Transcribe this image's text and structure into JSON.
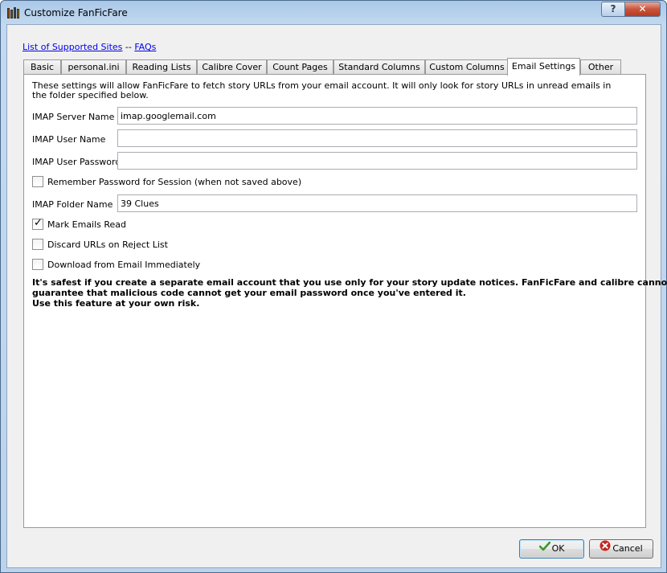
{
  "window": {
    "title": "Customize FanFicFare"
  },
  "links": {
    "supported_sites": "List of Supported Sites",
    "separator": "--",
    "faqs": "FAQs"
  },
  "tabs": [
    {
      "label": "Basic"
    },
    {
      "label": "personal.ini"
    },
    {
      "label": "Reading Lists"
    },
    {
      "label": "Calibre Cover"
    },
    {
      "label": "Count Pages"
    },
    {
      "label": "Standard Columns"
    },
    {
      "label": "Custom Columns"
    },
    {
      "label": "Email Settings",
      "active": true
    },
    {
      "label": "Other"
    }
  ],
  "email": {
    "description": "These settings will allow FanFicFare to fetch story URLs from your email account.  It will only look for story URLs in unread emails in the folder specified below.",
    "server_label": "IMAP Server Name",
    "server_value": "imap.googlemail.com",
    "user_label": "IMAP User Name",
    "user_value": "",
    "password_label": "IMAP User Password",
    "password_value": "",
    "remember_label": "Remember Password for Session (when not saved above)",
    "remember_checked": false,
    "folder_label": "IMAP Folder Name",
    "folder_value": "39 Clues",
    "mark_read_label": "Mark Emails Read",
    "mark_read_checked": true,
    "discard_label": "Discard URLs on Reject List",
    "discard_checked": false,
    "download_label": "Download from Email Immediately",
    "download_checked": false,
    "warning_line1": "It's safest if you create a separate email account that you use only for your story update notices. FanFicFare and calibre cannot",
    "warning_line2": "guarantee that malicious code cannot get your email password once you've entered it.",
    "warning_line3": "Use this feature at your own risk."
  },
  "buttons": {
    "ok": "OK",
    "cancel": "Cancel"
  },
  "icons": {
    "app": "books-icon",
    "help": "help-icon",
    "close": "close-icon",
    "ok": "checkmark-icon",
    "cancel": "cancel-icon"
  },
  "colors": {
    "link": "#0000ee",
    "ok_icon": "#3a9a2a",
    "cancel_icon": "#c8231b"
  }
}
